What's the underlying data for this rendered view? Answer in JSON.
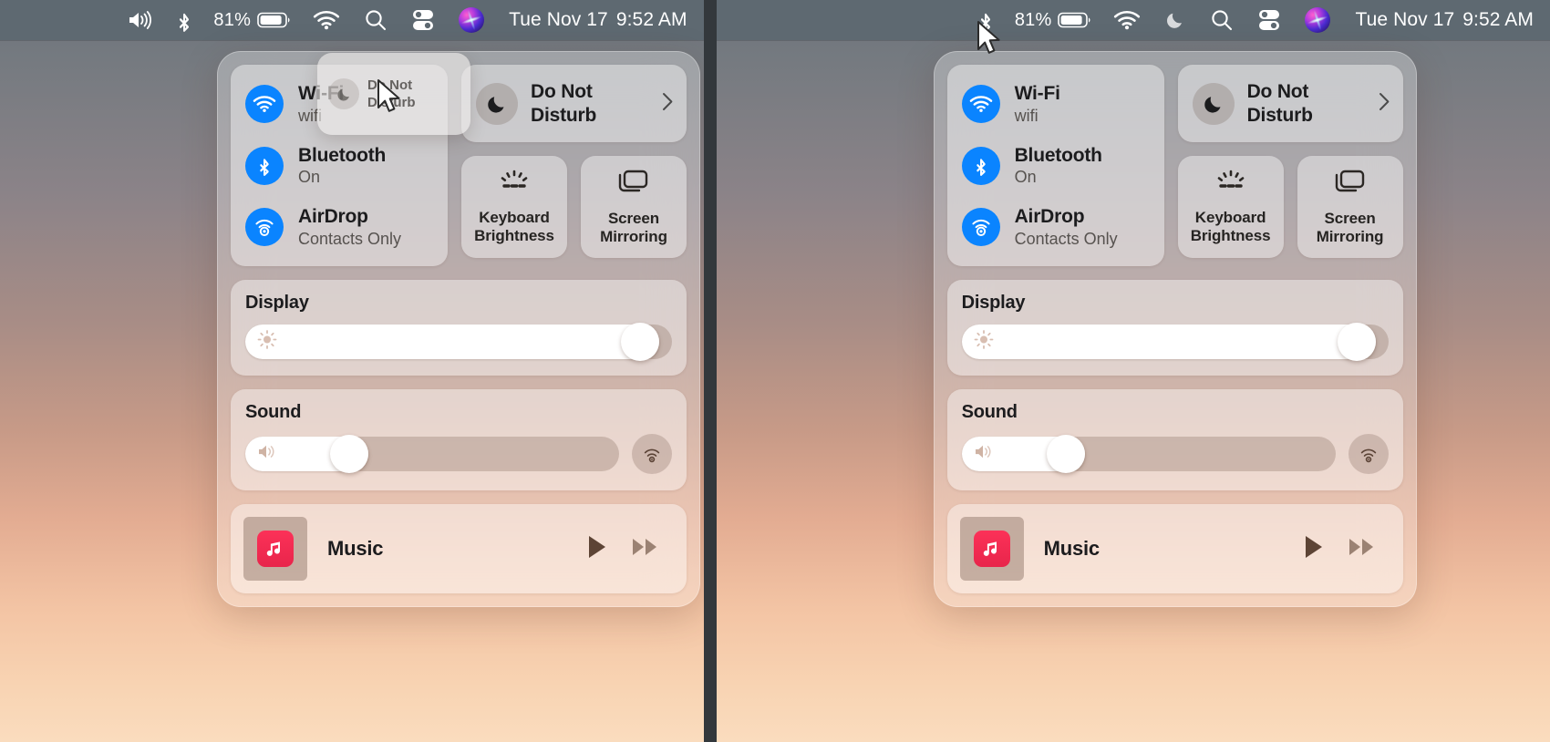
{
  "menubar": {
    "left_icons": [
      "volume-icon",
      "bluetooth-icon",
      "battery-icon",
      "wifi-icon",
      "search-icon",
      "control-center-icon",
      "siri-icon"
    ],
    "right_icons": [
      "bluetooth-icon",
      "battery-icon",
      "wifi-icon",
      "do-not-disturb-icon",
      "search-icon",
      "control-center-icon",
      "siri-icon"
    ],
    "battery_percent": "81%",
    "date": "Tue Nov 17",
    "time": "9:52 AM"
  },
  "control_center": {
    "toggles": [
      {
        "icon": "wifi-icon",
        "name": "Wi-Fi",
        "status": "wifi"
      },
      {
        "icon": "bluetooth-icon",
        "name": "Bluetooth",
        "status": "On"
      },
      {
        "icon": "airdrop-icon",
        "name": "AirDrop",
        "status": "Contacts Only"
      }
    ],
    "do_not_disturb": {
      "icon": "moon-icon",
      "line1": "Do Not",
      "line2": "Disturb",
      "chevron": "chevron-right-icon"
    },
    "squares": [
      {
        "icon": "keyboard-brightness-icon",
        "line1": "Keyboard",
        "line2": "Brightness"
      },
      {
        "icon": "screen-mirroring-icon",
        "line1": "Screen",
        "line2": "Mirroring"
      }
    ],
    "display": {
      "title": "Display",
      "icon": "brightness-icon",
      "value": 97
    },
    "sound": {
      "title": "Sound",
      "icon": "speaker-icon",
      "value": 33,
      "output_icon": "airplay-audio-icon"
    },
    "music": {
      "app_icon": "apple-music-icon",
      "title": "Music",
      "play_icon": "play-icon",
      "next_icon": "fast-forward-icon"
    }
  },
  "drag_ghost": {
    "icon": "moon-icon",
    "line1": "Do Not",
    "line2": "Disturb"
  },
  "colors": {
    "accent_blue": "#0a84ff",
    "menubar_bg": "#5e6971",
    "music_red": "#fc3158"
  }
}
